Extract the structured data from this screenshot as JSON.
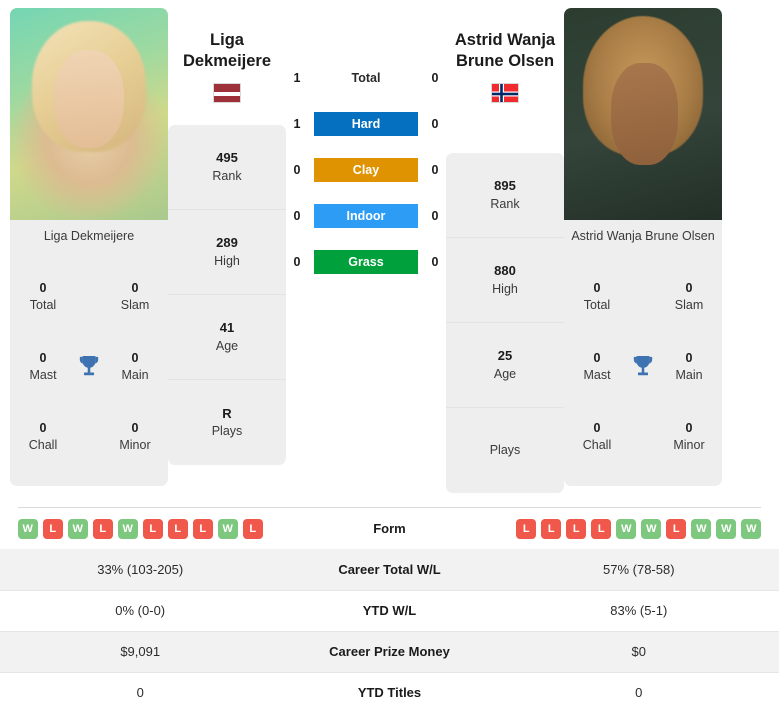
{
  "players": {
    "left": {
      "name": "Liga Dekmeijere",
      "name_line1": "Liga",
      "name_line2": "Dekmeijere",
      "photo_caption": "Liga Dekmeijere",
      "country_flag": "latvia-flag",
      "rank": "495",
      "rank_label": "Rank",
      "high": "289",
      "high_label": "High",
      "age": "41",
      "age_label": "Age",
      "plays": "R",
      "plays_label": "Plays",
      "titles": {
        "total": "0",
        "total_label": "Total",
        "slam": "0",
        "slam_label": "Slam",
        "mast": "0",
        "mast_label": "Mast",
        "main": "0",
        "main_label": "Main",
        "chall": "0",
        "chall_label": "Chall",
        "minor": "0",
        "minor_label": "Minor"
      },
      "form": [
        "W",
        "L",
        "W",
        "L",
        "W",
        "L",
        "L",
        "L",
        "W",
        "L"
      ],
      "career_wl": "33% (103-205)",
      "ytd_wl": "0% (0-0)",
      "prize_money": "$9,091",
      "ytd_titles": "0"
    },
    "right": {
      "name": "Astrid Wanja Brune Olsen",
      "name_line1": "Astrid Wanja",
      "name_line2": "Brune Olsen",
      "photo_caption": "Astrid Wanja Brune Olsen",
      "country_flag": "norway-flag",
      "rank": "895",
      "rank_label": "Rank",
      "high": "880",
      "high_label": "High",
      "age": "25",
      "age_label": "Age",
      "plays": "",
      "plays_label": "Plays",
      "titles": {
        "total": "0",
        "total_label": "Total",
        "slam": "0",
        "slam_label": "Slam",
        "mast": "0",
        "mast_label": "Mast",
        "main": "0",
        "main_label": "Main",
        "chall": "0",
        "chall_label": "Chall",
        "minor": "0",
        "minor_label": "Minor"
      },
      "form": [
        "L",
        "L",
        "L",
        "L",
        "W",
        "W",
        "L",
        "W",
        "W",
        "W"
      ],
      "career_wl": "57% (78-58)",
      "ytd_wl": "83% (5-1)",
      "prize_money": "$0",
      "ytd_titles": "0"
    }
  },
  "head_to_head": [
    {
      "label": "Total",
      "left": "1",
      "right": "0",
      "color": "",
      "plain": true
    },
    {
      "label": "Hard",
      "left": "1",
      "right": "0",
      "color": "#0570c0",
      "plain": false
    },
    {
      "label": "Clay",
      "left": "0",
      "right": "0",
      "color": "#e09300",
      "plain": false
    },
    {
      "label": "Indoor",
      "left": "0",
      "right": "0",
      "color": "#2d9cf5",
      "plain": false
    },
    {
      "label": "Grass",
      "left": "0",
      "right": "0",
      "color": "#00a03c",
      "plain": false
    }
  ],
  "comparison_rows": [
    {
      "label": "Form",
      "left": "",
      "right": "",
      "type": "form"
    },
    {
      "label": "Career Total W/L",
      "left": "33% (103-205)",
      "right": "57% (78-58)",
      "type": "text"
    },
    {
      "label": "YTD W/L",
      "left": "0% (0-0)",
      "right": "83% (5-1)",
      "type": "text"
    },
    {
      "label": "Career Prize Money",
      "left": "$9,091",
      "right": "$0",
      "type": "text"
    },
    {
      "label": "YTD Titles",
      "left": "0",
      "right": "0",
      "type": "text"
    }
  ],
  "colors": {
    "hard": "#0570c0",
    "clay": "#e09300",
    "indoor": "#2d9cf5",
    "grass": "#00a03c",
    "win_badge": "#7dc77f",
    "loss_badge": "#f0584b",
    "trophy": "#3e72b0",
    "card_bg": "#eeeeee"
  }
}
